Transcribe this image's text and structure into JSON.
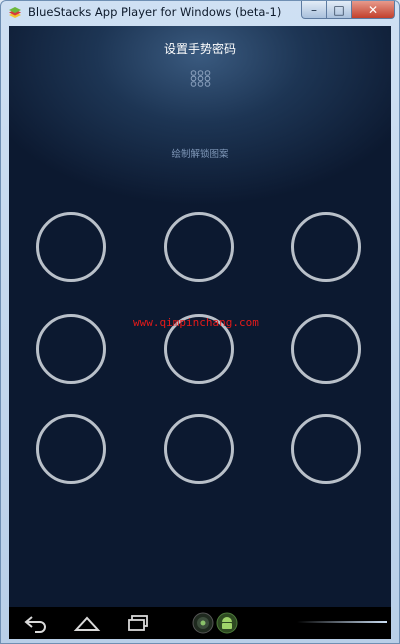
{
  "window": {
    "title": "BlueStacks App Player for Windows (beta-1)",
    "controls": {
      "minimize": "–",
      "maximize": "□",
      "close": "✕"
    }
  },
  "screen": {
    "title": "设置手势密码",
    "hint": "绘制解锁图案",
    "watermark": "www.qimpinchang.com",
    "pattern_dots": 9
  },
  "navbar": {
    "icons": [
      "back-icon",
      "home-icon",
      "recent-apps-icon",
      "bluestacks-icon",
      "android-icon"
    ]
  },
  "colors": {
    "background_top": "#3a5a7f",
    "background_bottom": "#0c1930",
    "dot_ring": "#b9c0c9",
    "hint_text": "#7f97b8",
    "watermark": "#e41a1a"
  }
}
